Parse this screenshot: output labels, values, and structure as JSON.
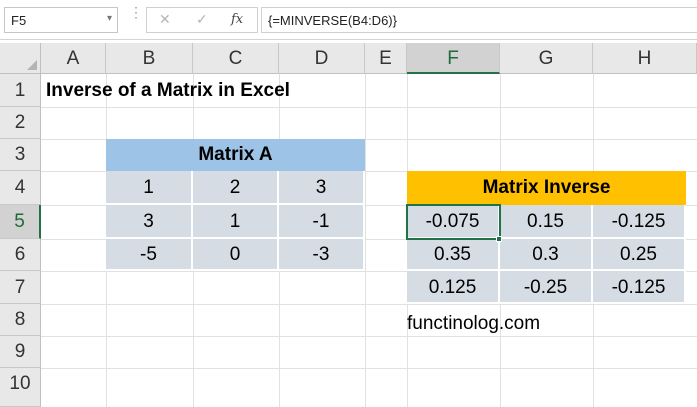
{
  "formula_bar": {
    "name_box": "F5",
    "name_box_dropdown": "▾",
    "dots": "⋮",
    "cancel": "✕",
    "enter": "✓",
    "fx": "fx",
    "formula": "{=MINVERSE(B4:D6)}"
  },
  "columns": [
    "A",
    "B",
    "C",
    "D",
    "E",
    "F",
    "G",
    "H"
  ],
  "rows": [
    "1",
    "2",
    "3",
    "4",
    "5",
    "6",
    "7",
    "8",
    "9",
    "10"
  ],
  "sheet": {
    "title": "Inverse of a Matrix in Excel",
    "matrix_a": {
      "header": "Matrix A",
      "header_color": "#9dc3e6",
      "cell_color": "#d6dce4",
      "values": [
        [
          "1",
          "2",
          "3"
        ],
        [
          "3",
          "1",
          "-1"
        ],
        [
          "-5",
          "0",
          "-3"
        ]
      ]
    },
    "matrix_inverse": {
      "header": "Matrix Inverse",
      "header_color": "#ffc000",
      "cell_color": "#d6dce4",
      "values": [
        [
          "-0.075",
          "0.15",
          "-0.125"
        ],
        [
          "0.35",
          "0.3",
          "0.25"
        ],
        [
          "0.125",
          "-0.25",
          "-0.125"
        ]
      ]
    },
    "website": "functinolog.com"
  },
  "selection": {
    "active_cell": "F5",
    "accent": "#217346"
  }
}
